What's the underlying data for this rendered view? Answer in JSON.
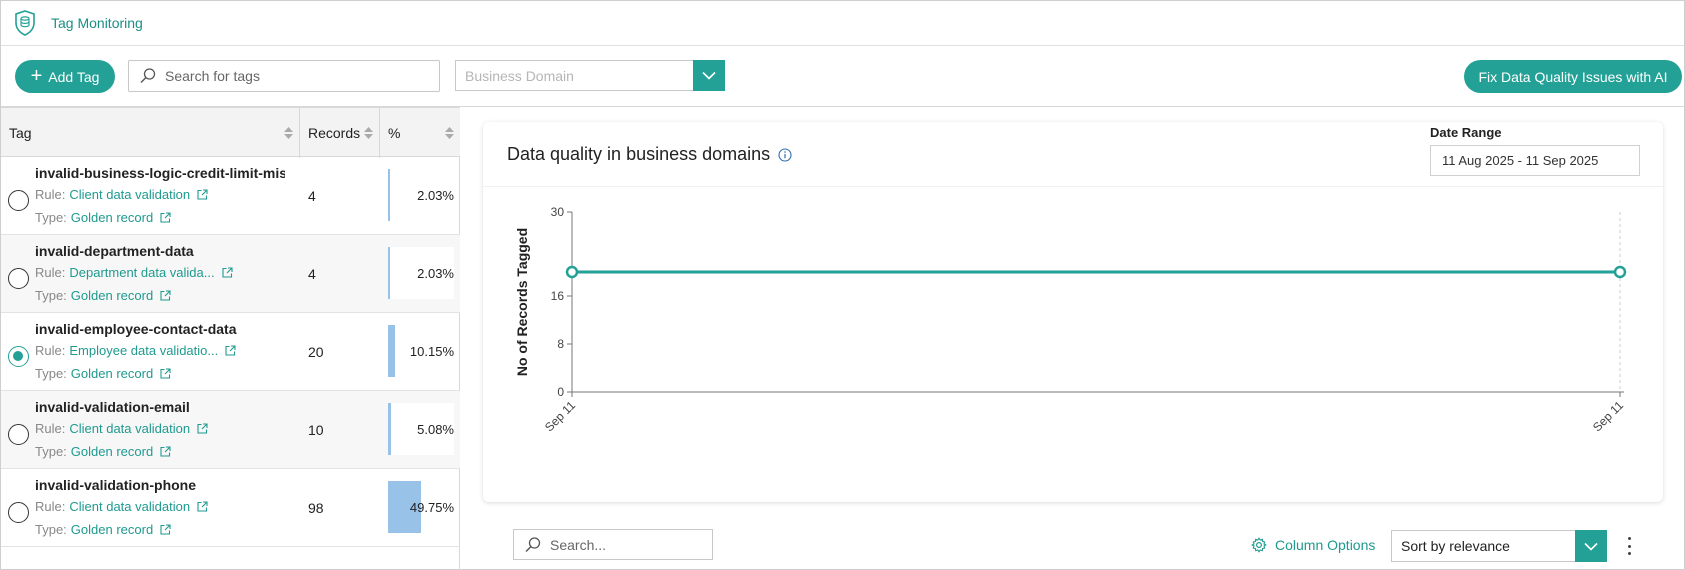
{
  "app": {
    "title": "Tag Monitoring",
    "icon": "database-shield-icon",
    "accent_color": "#23a196"
  },
  "toolbar": {
    "add_tag_label": "Add Tag",
    "search_placeholder": "Search for tags",
    "domain_placeholder": "Business Domain",
    "fix_label": "Fix Data Quality Issues with AI"
  },
  "table": {
    "columns": [
      "Tag",
      "Records",
      "%"
    ],
    "rows": [
      {
        "name": "invalid-business-logic-credit-limit-mis...",
        "rule_prefix": "Rule:",
        "rule": "Client data validation",
        "type_prefix": "Type:",
        "type": "Golden record",
        "records": "4",
        "percent": "2.03%",
        "fraction": 0.0203,
        "selected": false
      },
      {
        "name": "invalid-department-data",
        "rule_prefix": "Rule:",
        "rule": "Department data valida...",
        "type_prefix": "Type:",
        "type": "Golden record",
        "records": "4",
        "percent": "2.03%",
        "fraction": 0.0203,
        "selected": false
      },
      {
        "name": "invalid-employee-contact-data",
        "rule_prefix": "Rule:",
        "rule": "Employee data validatio...",
        "type_prefix": "Type:",
        "type": "Golden record",
        "records": "20",
        "percent": "10.15%",
        "fraction": 0.1015,
        "selected": true
      },
      {
        "name": "invalid-validation-email",
        "rule_prefix": "Rule:",
        "rule": "Client data validation",
        "type_prefix": "Type:",
        "type": "Golden record",
        "records": "10",
        "percent": "5.08%",
        "fraction": 0.0508,
        "selected": false
      },
      {
        "name": "invalid-validation-phone",
        "rule_prefix": "Rule:",
        "rule": "Client data validation",
        "type_prefix": "Type:",
        "type": "Golden record",
        "records": "98",
        "percent": "49.75%",
        "fraction": 0.4975,
        "selected": false
      }
    ]
  },
  "chart_panel": {
    "title": "Data quality in business domains",
    "date_range_label": "Date Range",
    "date_range_value": "11 Aug 2025 - 11 Sep 2025"
  },
  "chart_data": {
    "type": "line",
    "title": "Data quality in business domains",
    "xlabel": "",
    "ylabel": "No of Records Tagged",
    "x": [
      "Sep 11",
      "Sep 11"
    ],
    "series": [
      {
        "values": [
          20,
          20
        ]
      }
    ],
    "yticks": [
      0,
      8,
      16,
      30
    ],
    "ylim": [
      0,
      30
    ],
    "line_color": "#23a196",
    "grid": false
  },
  "bottom": {
    "search_placeholder": "Search...",
    "column_options_label": "Column Options",
    "sort_value": "Sort by relevance"
  }
}
